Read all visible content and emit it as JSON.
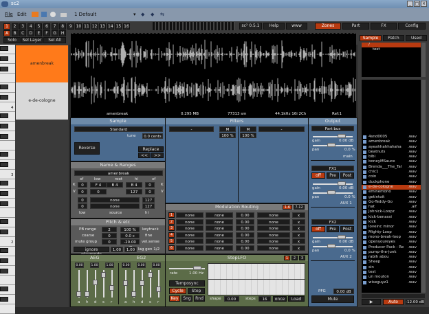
{
  "window": {
    "title": "sc2",
    "min": "_",
    "max": "□",
    "close": "×"
  },
  "menu": {
    "file": "File",
    "edit": "Edit",
    "preset": "1 Default"
  },
  "parts": [
    "1",
    "2",
    "3",
    "4",
    "5",
    "6",
    "7",
    "8",
    "9",
    "10",
    "11",
    "12",
    "13",
    "14",
    "15",
    "16"
  ],
  "layers": [
    "A",
    "B",
    "C",
    "D",
    "E",
    "F",
    "G",
    "H"
  ],
  "layer_buttons": {
    "solo": "Solo",
    "sel_layer": "Sel Layer",
    "sel_all": "Sel All"
  },
  "header": {
    "version": "sc² 0.5.1",
    "help": "Help",
    "www": "www",
    "tabs": [
      "Zones",
      "Part",
      "FX",
      "Config"
    ],
    "active_tab": "Zones"
  },
  "zones": [
    {
      "name": "amenbreak",
      "selected": true
    },
    {
      "name": "e-de-cologne",
      "selected": false
    }
  ],
  "keyboard": {
    "octave_labels": [
      "4",
      "3",
      "2"
    ]
  },
  "waveform_info": {
    "name": "amenbreak",
    "size": "0.295 MB",
    "samples": "77313 sm",
    "format": "44.1kHz 16i 2Ch",
    "ref": "Ref:1"
  },
  "sample": {
    "title": "Sample",
    "mode": "Standard",
    "tune_label": "tune",
    "tune": "0.0 cents",
    "reverse": "Reverse",
    "replace": "Replace",
    "prev": "<<",
    "next": ">>"
  },
  "name_ranges": {
    "title": "Name & Ranges",
    "name": "amenbreak",
    "cols": [
      "xf",
      "low",
      "root",
      "hi",
      "xf"
    ],
    "k_label": "K",
    "v_label": "V",
    "k": [
      "0",
      "F 4",
      "B 4",
      "B 4",
      "0"
    ],
    "v": [
      "0",
      "0",
      "127",
      "0"
    ],
    "sources": [
      {
        "low": "0",
        "source": "none",
        "hi": "127"
      },
      {
        "low": "0",
        "source": "none",
        "hi": "127"
      }
    ],
    "foot": [
      "low",
      "source",
      "hi"
    ]
  },
  "pitch": {
    "title": "Pitch & etc",
    "pb_label": "PB range",
    "pb": "2",
    "keytrack": "100 %",
    "keytrack_label": "keytrack",
    "coarse_label": "coarse",
    "coarse": "0",
    "fine": "0.0 c",
    "fine_label": "fine",
    "mute_label": "mute group",
    "mute": "0",
    "velsense": "-20.00 dB",
    "velsense_label": "vel.sense",
    "ignore": "ignore playmode",
    "lag1": "1.00 s",
    "lag2": "1.00 s",
    "lag_label": "lag gen 1/2"
  },
  "filters": {
    "title": "Filters",
    "f1": "-",
    "f2": "-",
    "m1": "M",
    "m2": "M",
    "mix1": "100 %",
    "mix2": "100 %"
  },
  "mod": {
    "title": "Modulation Routing",
    "page1": "1-6",
    "page2": "7-12",
    "rows": [
      {
        "n": "1",
        "src": "none",
        "src2": "none",
        "amt": "0.00",
        "dst": "none",
        "op": "x"
      },
      {
        "n": "2",
        "src": "none",
        "src2": "none",
        "amt": "0.00",
        "dst": "none",
        "op": "x"
      },
      {
        "n": "3",
        "src": "none",
        "src2": "none",
        "amt": "0.00",
        "dst": "none",
        "op": "x"
      },
      {
        "n": "4",
        "src": "none",
        "src2": "none",
        "amt": "0.00",
        "dst": "none",
        "op": "x"
      },
      {
        "n": "5",
        "src": "none",
        "src2": "none",
        "amt": "0.00",
        "dst": "none",
        "op": "x"
      },
      {
        "n": "6",
        "src": "none",
        "src2": "none",
        "amt": "0.00",
        "dst": "none",
        "op": "x"
      }
    ]
  },
  "aeg": {
    "title": "AEG",
    "values": [
      "0.00",
      "1.00",
      "1.00"
    ],
    "labels": [
      "a",
      "h",
      "d",
      "s",
      "r"
    ],
    "levels": [
      0.1,
      0.1,
      0.6,
      0.9,
      0.35
    ]
  },
  "eg2": {
    "title": "EG2",
    "values": [
      "0.00",
      "0.00",
      "0.00"
    ],
    "labels": [
      "a",
      "h",
      "d",
      "s",
      "r"
    ],
    "levels": [
      0.55,
      0.1,
      0.55,
      0.9,
      0.3
    ]
  },
  "lfo": {
    "title": "StepLFO",
    "pages": [
      "1",
      "2",
      "3"
    ],
    "rate_label": "rate",
    "rate": "1.00 Hz",
    "temposync": "Temposync",
    "cycle": "Cycle",
    "step": "Step",
    "key": "Key",
    "sng": "Sng",
    "rnd": "Rnd",
    "shape_label": "shape",
    "shape": "0.00",
    "steps_label": "steps",
    "steps": "16",
    "once": "once",
    "load": "Load"
  },
  "output": {
    "title": "Output",
    "bus": "Part bus",
    "gain_label": "gain",
    "gain": "0.00 dB",
    "pan_label": "pan",
    "pan": "0.0 %",
    "main": "main",
    "fx1": {
      "name": "FX1",
      "off": "off",
      "pre": "Pre",
      "post": "Post",
      "gain": "0.00 dB",
      "pan": "0.0 %",
      "label": "AUX 1"
    },
    "fx2": {
      "name": "FX2",
      "off": "off",
      "pre": "Pre",
      "post": "Post",
      "gain": "0.00 dB",
      "pan": "0.0 %",
      "label": "AUX 2"
    },
    "pfg_label": "PFG",
    "pfg": "0.00 dB",
    "mute": "Mute"
  },
  "browser": {
    "tabs": [
      "Sample",
      "Patch",
      "Used"
    ],
    "active": "Sample",
    "tree": [
      "/",
      "test"
    ],
    "files": [
      [
        "4snd0005",
        ".wav"
      ],
      [
        "amenbreak",
        ".wav"
      ],
      [
        "ayeahhahhahaha",
        ".wav"
      ],
      [
        "beatnuts",
        ".wav"
      ],
      [
        "bibi",
        ".wav"
      ],
      [
        "boneyMSauce",
        ".wav"
      ],
      [
        "Brenda___The_Tal",
        ".wav"
      ],
      [
        "chic1",
        ".wav"
      ],
      [
        "coin",
        ".wav"
      ],
      [
        "duckphone",
        ".wav"
      ],
      [
        "e-de-cologne",
        ".wav"
      ],
      [
        "eminemono",
        ".wav"
      ],
      [
        "getintoit",
        ".wav"
      ],
      [
        "Go-Teddy-Go",
        ".wav"
      ],
      [
        "hat",
        ".aif"
      ],
      [
        "Johnick-Loopz",
        ".wav"
      ],
      [
        "kick-benassi",
        ".wav"
      ],
      [
        "kick",
        ".wav"
      ],
      [
        "loveinc minor",
        ".wav"
      ],
      [
        "Mighty-Loop",
        ".wav"
      ],
      [
        "mono-break-loop",
        ".wav"
      ],
      [
        "openyoureyes",
        ".wav"
      ],
      [
        "Producer Pack - Re",
        ".wav"
      ],
      [
        "pump-the-junk",
        ".wav"
      ],
      [
        "rabih abou",
        ".wav"
      ],
      [
        "Sheep",
        ".wav"
      ],
      [
        "sin",
        ".wav"
      ],
      [
        "test",
        ".wav"
      ],
      [
        "un mouton",
        ".wav"
      ],
      [
        "wiseguyz1",
        ".wav"
      ]
    ],
    "selected_index": 10,
    "play": "▶",
    "auto": "Auto",
    "level": "-12.00 dB"
  },
  "colors": {
    "accent": "#b83a10",
    "zone_selected": "#ff7a1a",
    "panel_blue": "#4a6a8e",
    "panel_green": "#5c6c48"
  }
}
